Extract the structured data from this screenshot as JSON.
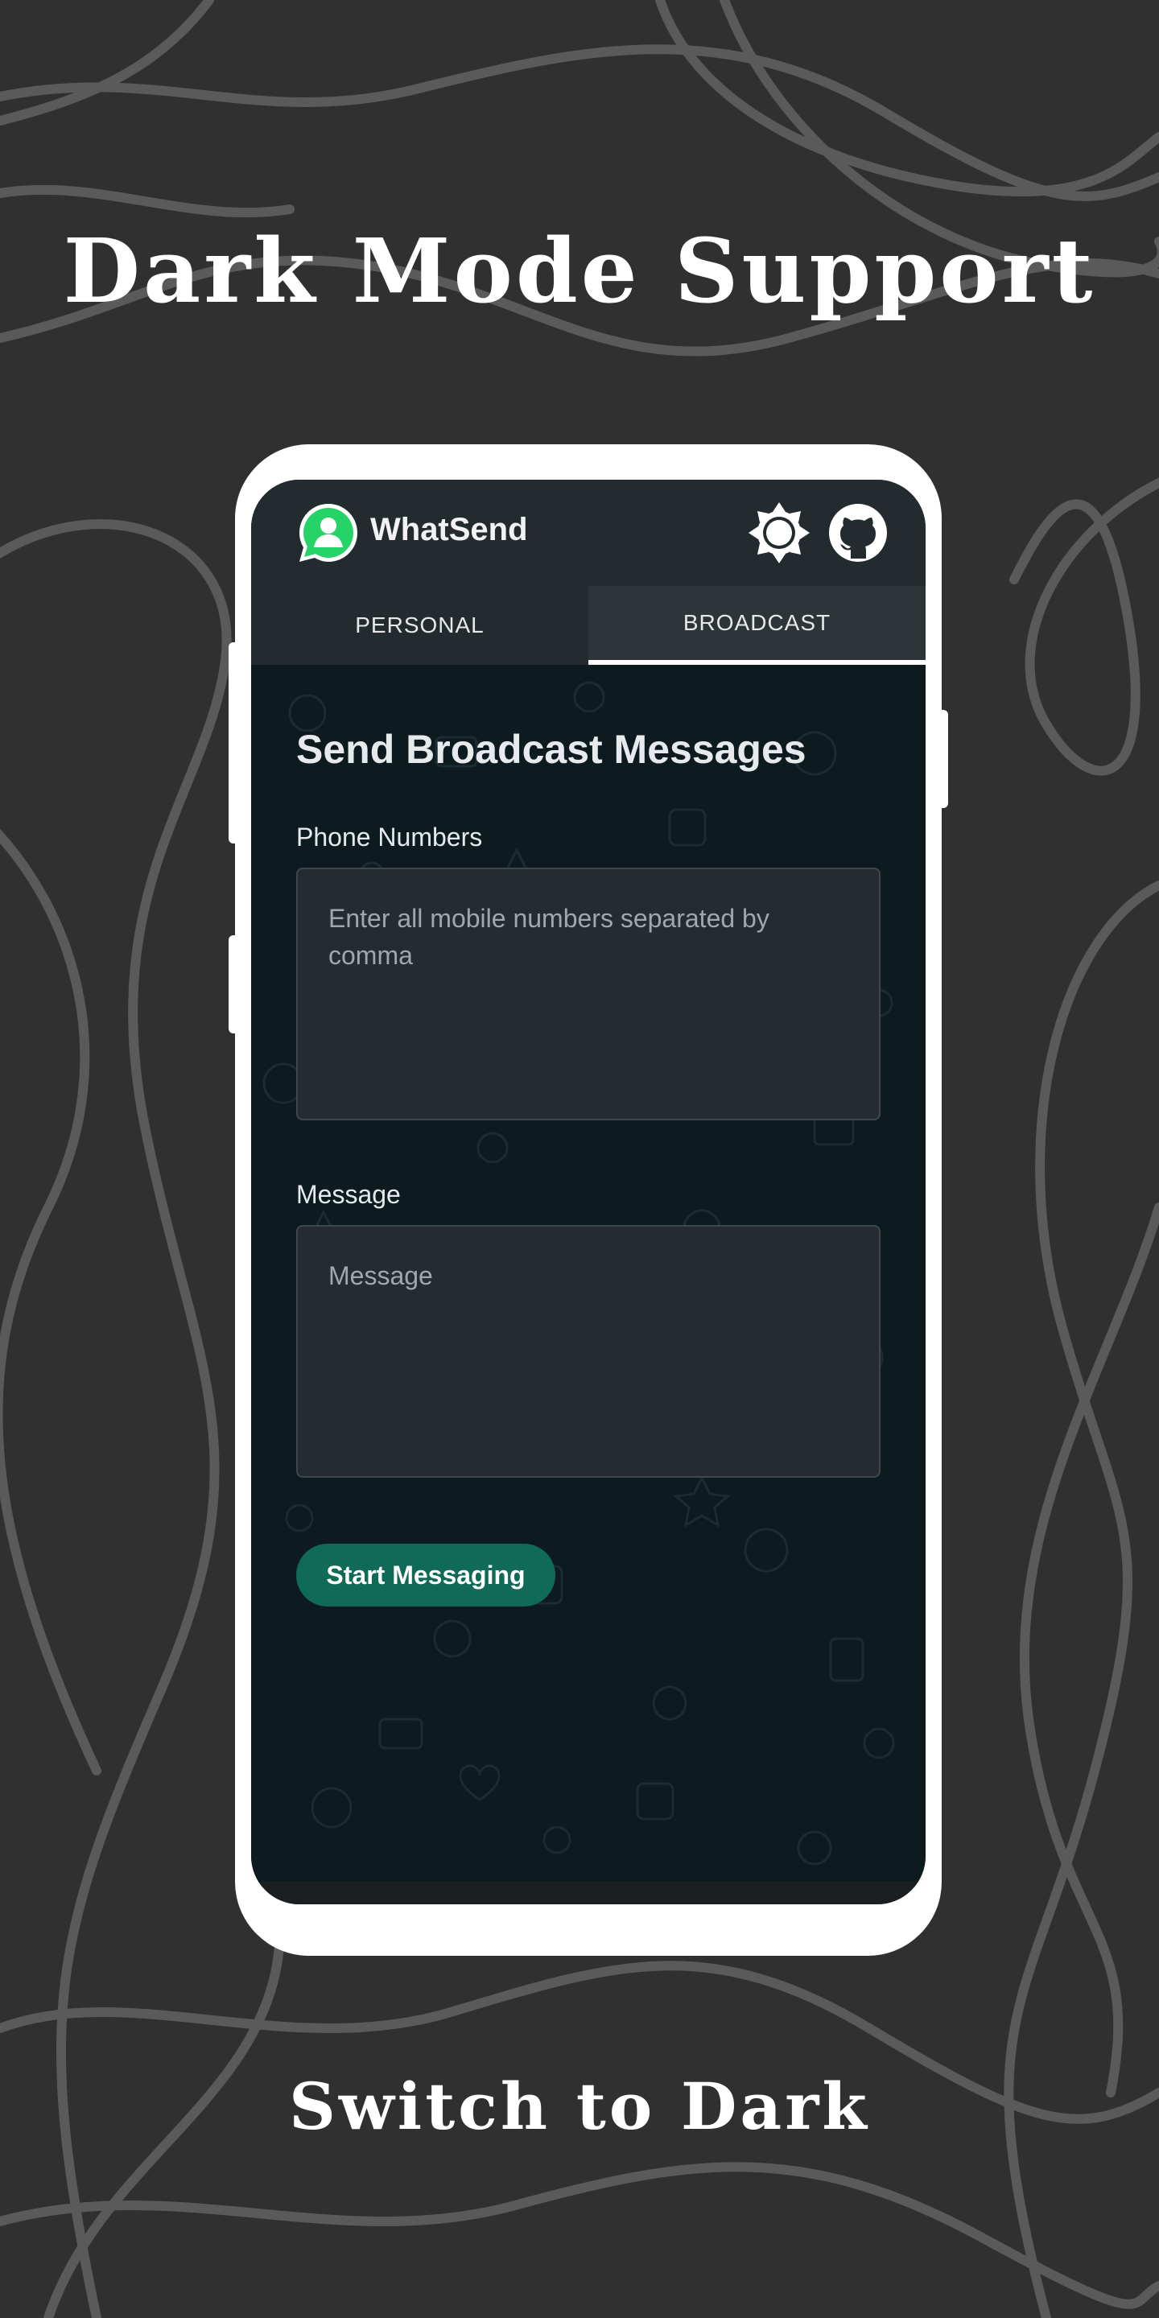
{
  "promo": {
    "top_title": "Dark Mode Support",
    "bottom_title": "Switch to Dark"
  },
  "app": {
    "title": "WhatSend",
    "logo_icon": "whatsapp-user-icon",
    "theme_toggle_icon": "sun-icon",
    "github_icon": "github-icon"
  },
  "tabs": [
    {
      "label": "PERSONAL",
      "active": false
    },
    {
      "label": "BROADCAST",
      "active": true
    }
  ],
  "form": {
    "heading": "Send Broadcast Messages",
    "phone_label": "Phone Numbers",
    "phone_placeholder": "Enter all mobile numbers separated by comma",
    "phone_value": "",
    "message_label": "Message",
    "message_placeholder": "Message",
    "message_value": "",
    "submit_label": "Start Messaging"
  },
  "colors": {
    "background": "#303030",
    "appbar": "#232b2f",
    "content_bg": "#0d1b21",
    "accent_button": "#0f6a57",
    "logo_green": "#25d366"
  }
}
